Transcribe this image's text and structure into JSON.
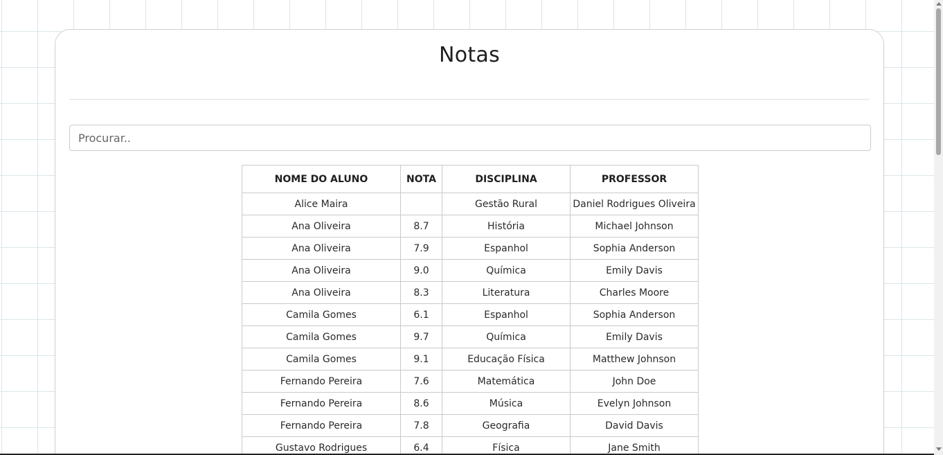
{
  "page": {
    "title": "Notas"
  },
  "search": {
    "placeholder": "Procurar.."
  },
  "table": {
    "headers": [
      "NOME DO ALUNO",
      "NOTA",
      "DISCIPLINA",
      "PROFESSOR"
    ],
    "rows": [
      [
        "Alice Maira",
        "",
        "Gestão Rural",
        "Daniel Rodrigues Oliveira"
      ],
      [
        "Ana Oliveira",
        "8.7",
        "História",
        "Michael Johnson"
      ],
      [
        "Ana Oliveira",
        "7.9",
        "Espanhol",
        "Sophia Anderson"
      ],
      [
        "Ana Oliveira",
        "9.0",
        "Química",
        "Emily Davis"
      ],
      [
        "Ana Oliveira",
        "8.3",
        "Literatura",
        "Charles Moore"
      ],
      [
        "Camila Gomes",
        "6.1",
        "Espanhol",
        "Sophia Anderson"
      ],
      [
        "Camila Gomes",
        "9.7",
        "Química",
        "Emily Davis"
      ],
      [
        "Camila Gomes",
        "9.1",
        "Educação Física",
        "Matthew Johnson"
      ],
      [
        "Fernando Pereira",
        "7.6",
        "Matemática",
        "John Doe"
      ],
      [
        "Fernando Pereira",
        "8.6",
        "Música",
        "Evelyn Johnson"
      ],
      [
        "Fernando Pereira",
        "7.8",
        "Geografia",
        "David Davis"
      ],
      [
        "Gustavo Rodrigues",
        "6.4",
        "Física",
        "Jane Smith"
      ]
    ]
  }
}
